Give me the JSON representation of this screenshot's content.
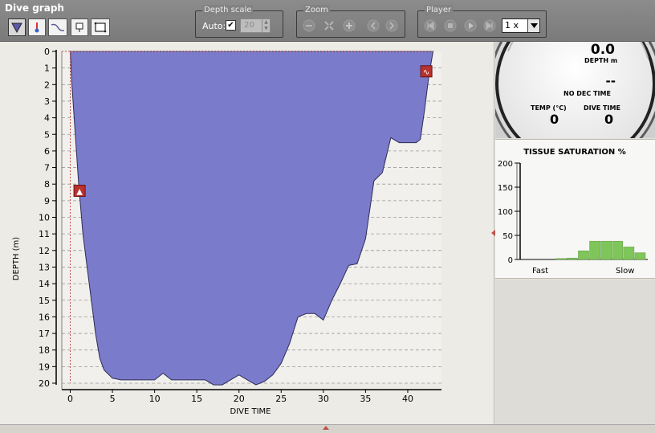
{
  "toolbar": {
    "title": "Dive graph",
    "depth_scale": {
      "title": "Depth scale",
      "auto_label": "Auto:",
      "auto_checked": true,
      "value": "20"
    },
    "zoom": {
      "title": "Zoom"
    },
    "player": {
      "title": "Player",
      "speed": "1 x"
    }
  },
  "graph": {
    "ylabel": "DEPTH (m)",
    "xlabel": "DIVE TIME",
    "y_ticks": [
      "0",
      "1",
      "2",
      "3",
      "4",
      "5",
      "6",
      "7",
      "8",
      "9",
      "10",
      "11",
      "12",
      "13",
      "14",
      "15",
      "16",
      "17",
      "18",
      "19",
      "20"
    ],
    "x_ticks": [
      "0",
      "5",
      "10",
      "15",
      "20",
      "25",
      "30",
      "35",
      "40"
    ],
    "fill_color": "#7b7bcc",
    "profile": [
      [
        0,
        0
      ],
      [
        0.2,
        2
      ],
      [
        0.6,
        5
      ],
      [
        1,
        8
      ],
      [
        1.5,
        11
      ],
      [
        2,
        13
      ],
      [
        2.5,
        15
      ],
      [
        3,
        17
      ],
      [
        3.5,
        18.5
      ],
      [
        4,
        19.2
      ],
      [
        5,
        19.7
      ],
      [
        6,
        19.8
      ],
      [
        7,
        19.8
      ],
      [
        8,
        19.8
      ],
      [
        9,
        19.8
      ],
      [
        10,
        19.8
      ],
      [
        11,
        19.4
      ],
      [
        12,
        19.8
      ],
      [
        13,
        19.8
      ],
      [
        14,
        19.8
      ],
      [
        15,
        19.8
      ],
      [
        16,
        19.8
      ],
      [
        17,
        20.1
      ],
      [
        18,
        20.1
      ],
      [
        19,
        19.8
      ],
      [
        20,
        19.5
      ],
      [
        21,
        19.8
      ],
      [
        22,
        20.1
      ],
      [
        23,
        19.9
      ],
      [
        24,
        19.5
      ],
      [
        25,
        18.8
      ],
      [
        26,
        17.6
      ],
      [
        27,
        16
      ],
      [
        28,
        15.8
      ],
      [
        29,
        15.8
      ],
      [
        30,
        16.2
      ],
      [
        31,
        15
      ],
      [
        32,
        14
      ],
      [
        33,
        12.9
      ],
      [
        34,
        12.8
      ],
      [
        35,
        11.3
      ],
      [
        36,
        7.8
      ],
      [
        37,
        7.3
      ],
      [
        38,
        5.2
      ],
      [
        39,
        5.5
      ],
      [
        40,
        5.5
      ],
      [
        41,
        5.5
      ],
      [
        41.5,
        5.3
      ],
      [
        42,
        3.5
      ],
      [
        42.5,
        1.5
      ],
      [
        43,
        0
      ]
    ],
    "markers": [
      {
        "name": "ascent-warning-marker",
        "time": 1.1,
        "depth": 8.4,
        "glyph": "▲"
      },
      {
        "name": "surface-warning-marker",
        "time": 42.2,
        "depth": 1.2,
        "glyph": "∿"
      }
    ]
  },
  "gauge": {
    "depth_value": "0.0",
    "depth_label": "DEPTH m",
    "ndt_value": "--",
    "ndt_label": "NO DEC TIME",
    "temp_label": "TEMP (°C)",
    "temp_value": "0",
    "dive_time_label": "DIVE TIME",
    "dive_time_value": "0"
  },
  "chart_data": {
    "type": "bar",
    "title": "TISSUE SATURATION %",
    "ylim": [
      0,
      200
    ],
    "y_ticks": [
      "0",
      "50",
      "100",
      "150",
      "200"
    ],
    "x_left_label": "Fast",
    "x_right_label": "Slow",
    "values": [
      0,
      0,
      0,
      2,
      3,
      18,
      38,
      38,
      38,
      26,
      14
    ],
    "bar_color": "#7fc65a"
  }
}
